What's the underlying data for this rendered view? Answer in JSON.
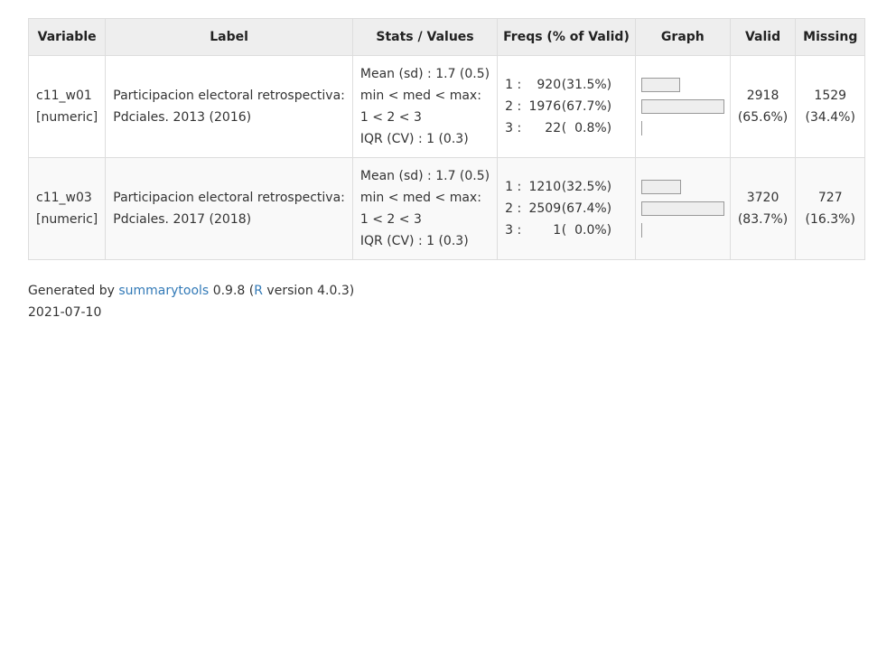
{
  "headers": [
    "Variable",
    "Label",
    "Stats / Values",
    "Freqs (% of Valid)",
    "Graph",
    "Valid",
    "Missing"
  ],
  "rows": [
    {
      "variable": "c11_w01",
      "type": "[numeric]",
      "label_line1": "Participacion electoral retrospectiva:",
      "label_line2": "Pdciales. 2013 (2016)",
      "stats": [
        "Mean (sd) : 1.7 (0.5)",
        "min < med < max:",
        "1 < 2 < 3",
        "IQR (CV) : 1 (0.3)"
      ],
      "freqs": [
        {
          "idx": "1 :",
          "n": "920",
          "pct": "(31.5%)",
          "frac": 0.315
        },
        {
          "idx": "2 :",
          "n": "1976",
          "pct": "(67.7%)",
          "frac": 0.677
        },
        {
          "idx": "3 :",
          "n": "22",
          "pct": "(  0.8%)",
          "frac": 0.008
        }
      ],
      "valid_n": "2918",
      "valid_pct": "(65.6%)",
      "missing_n": "1529",
      "missing_pct": "(34.4%)"
    },
    {
      "variable": "c11_w03",
      "type": "[numeric]",
      "label_line1": "Participacion electoral retrospectiva:",
      "label_line2": "Pdciales. 2017 (2018)",
      "stats": [
        "Mean (sd) : 1.7 (0.5)",
        "min < med < max:",
        "1 < 2 < 3",
        "IQR (CV) : 1 (0.3)"
      ],
      "freqs": [
        {
          "idx": "1 :",
          "n": "1210",
          "pct": "(32.5%)",
          "frac": 0.325
        },
        {
          "idx": "2 :",
          "n": "2509",
          "pct": "(67.4%)",
          "frac": 0.674
        },
        {
          "idx": "3 :",
          "n": "1",
          "pct": "(  0.0%)",
          "frac": 0.0
        }
      ],
      "valid_n": "3720",
      "valid_pct": "(83.7%)",
      "missing_n": "727",
      "missing_pct": "(16.3%)"
    }
  ],
  "footer": {
    "generated_by": "Generated by",
    "tool_name": "summarytools",
    "tool_version": "0.9.8 (",
    "r_link": "R",
    "r_version": "version 4.0.3)",
    "date": "2021-07-10"
  }
}
